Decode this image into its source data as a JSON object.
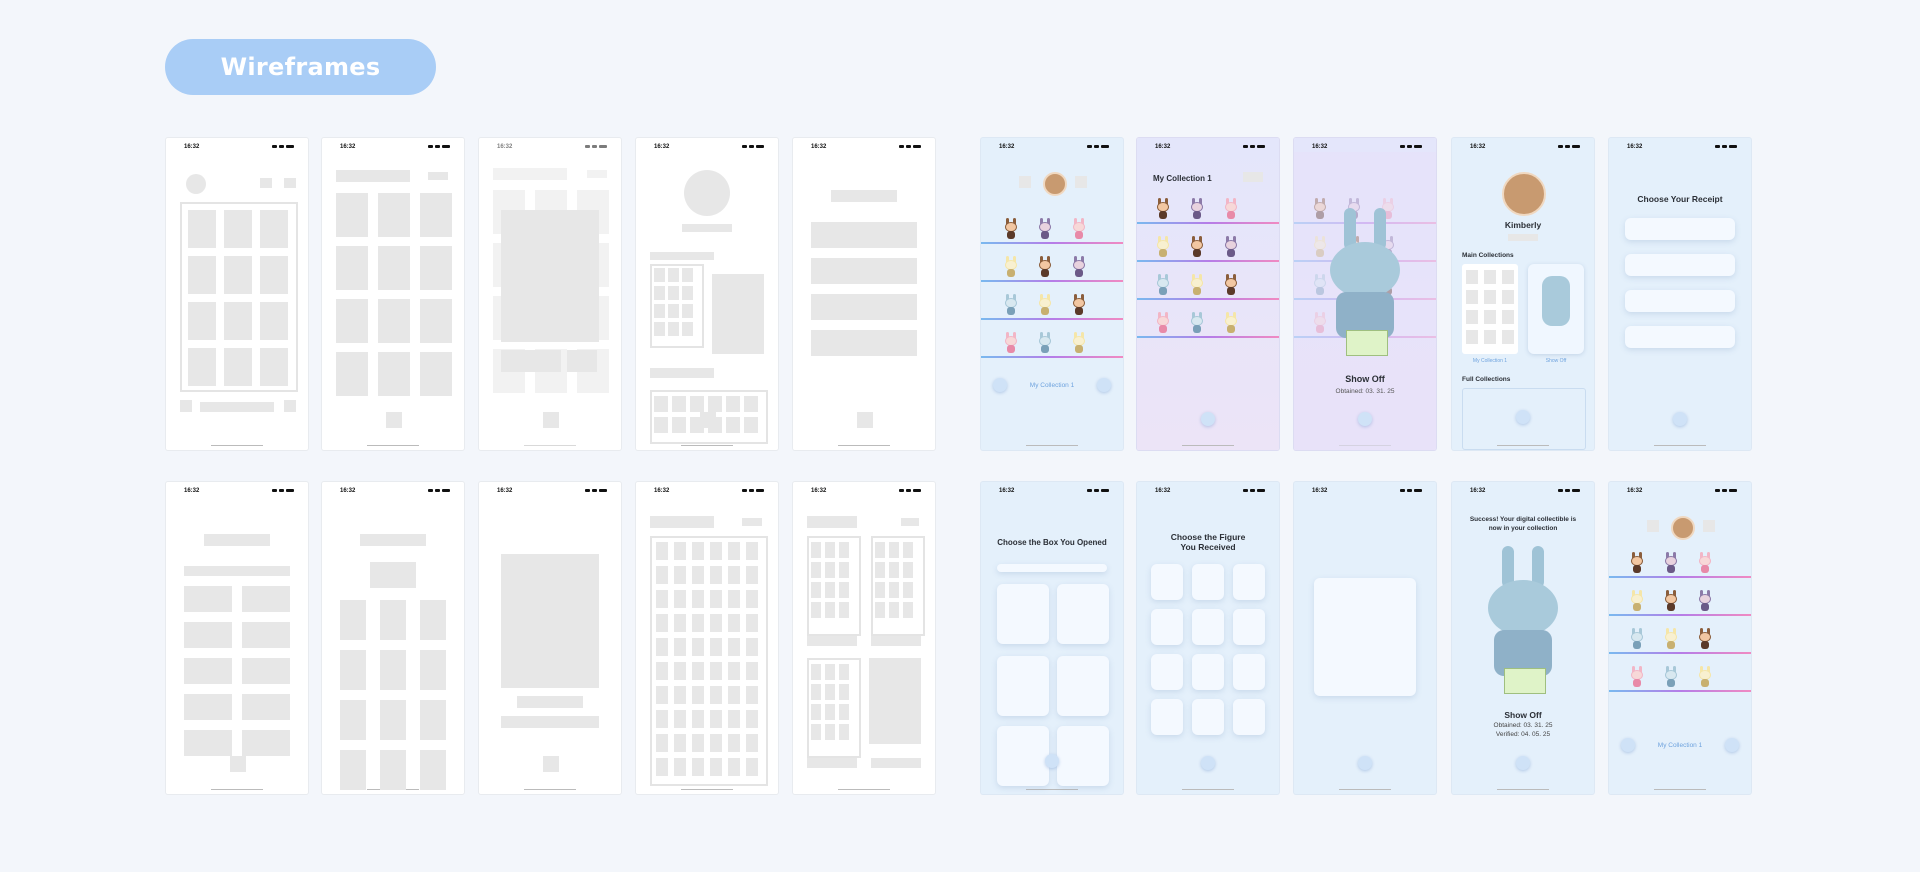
{
  "title": "Wireframes",
  "status_time": "16:32",
  "screens": {
    "collection_caption": "My Collection 1",
    "collection_title": "My Collection 1",
    "show_off": "Show Off",
    "obtained": "Obtained: 03. 31. 25",
    "profile_name": "Kimberly",
    "main_collections": "Main Collections",
    "my_collection_tag": "My Collection 1",
    "show_off_tag": "Show Off",
    "full_collections": "Full Collections",
    "choose_receipt": "Choose Your Receipt",
    "choose_box": "Choose the Box You Opened",
    "choose_figure_1": "Choose the Figure",
    "choose_figure_2": "You Received",
    "success_1": "Success! Your digital collectible is",
    "success_2": "now in your collection",
    "obtained_2": "Obtained: 03. 31. 25",
    "verified": "Verified: 04. 05. 25",
    "collection_caption_2": "My Collection 1"
  },
  "colors": {
    "accent": "#a9cdf6",
    "shelf_start": "#79b9ef",
    "shelf_end": "#f08ac2"
  }
}
